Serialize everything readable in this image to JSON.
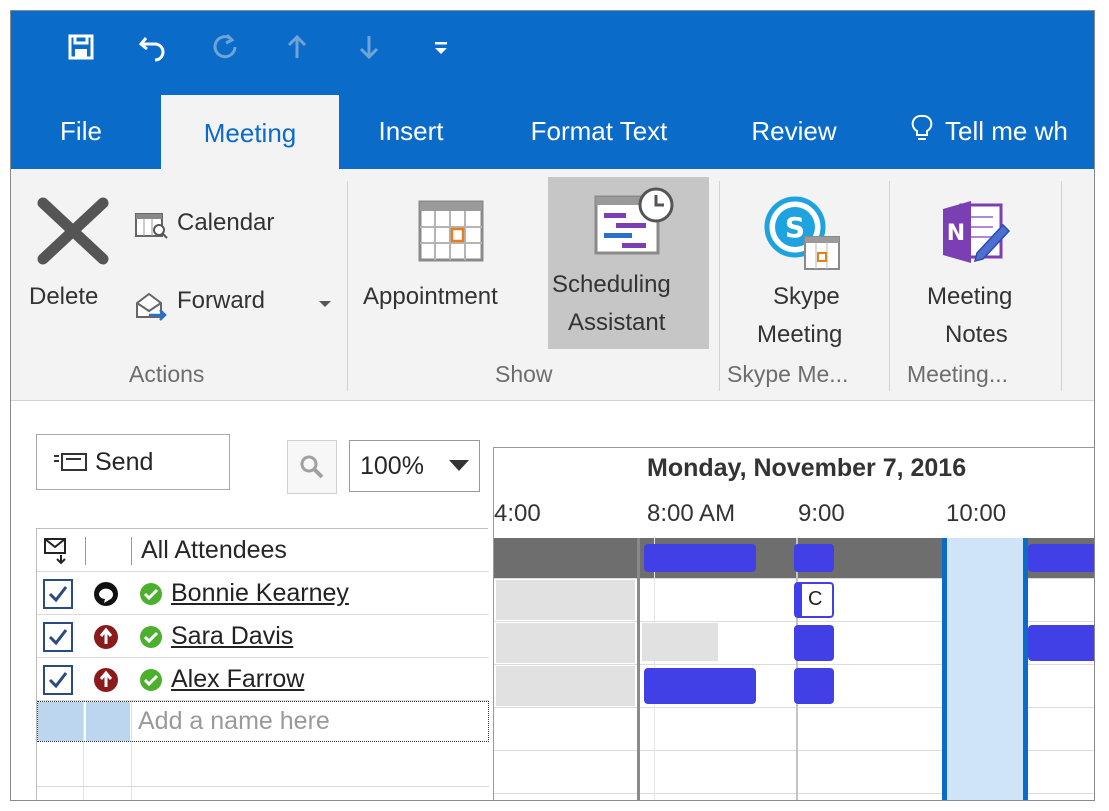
{
  "tabs": {
    "file": "File",
    "meeting": "Meeting",
    "insert": "Insert",
    "format_text": "Format Text",
    "review": "Review",
    "tell_me": "Tell me wh"
  },
  "ribbon": {
    "delete": "Delete",
    "calendar": "Calendar",
    "forward": "Forward",
    "appointment": "Appointment",
    "scheduling_line1": "Scheduling",
    "scheduling_line2": "Assistant",
    "skype_line1": "Skype",
    "skype_line2": "Meeting",
    "notes_line1": "Meeting",
    "notes_line2": "Notes",
    "groups": {
      "actions": "Actions",
      "show": "Show",
      "skype": "Skype Me...",
      "meeting": "Meeting..."
    }
  },
  "toolbar": {
    "send": "Send",
    "zoom": "100%"
  },
  "attendees": {
    "header": "All Attendees",
    "placeholder": "Add a name here",
    "rows": [
      {
        "name": "Bonnie Kearney",
        "role_icon": "organizer-icon"
      },
      {
        "name": "Sara Davis",
        "role_icon": "required-attendee-icon"
      },
      {
        "name": "Alex Farrow",
        "role_icon": "required-attendee-icon"
      }
    ]
  },
  "timeline": {
    "date": "Monday, November 7, 2016",
    "times": [
      "4:00",
      "8:00 AM",
      "9:00",
      "10:00"
    ],
    "badge": "C"
  },
  "colors": {
    "accent": "#0b6bc8",
    "busy": "#4040e6",
    "selection": "#cfe4f7",
    "selection_border": "#0b6bc8",
    "accepted": "#4caf2d",
    "required": "#8b1a1a"
  }
}
